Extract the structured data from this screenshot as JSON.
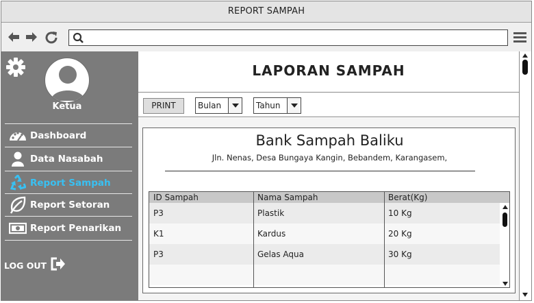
{
  "window": {
    "title": "REPORT SAMPAH"
  },
  "toolbar": {
    "back_icon": "arrow-left-icon",
    "forward_icon": "arrow-right-icon",
    "reload_icon": "reload-icon",
    "search_icon": "search-icon",
    "address_value": "",
    "menu_icon": "hamburger-menu-icon"
  },
  "sidebar": {
    "settings_icon": "gear-icon",
    "user_role": "Ketua",
    "items": [
      {
        "label": "Dashboard",
        "icon": "speedometer-icon",
        "active": false
      },
      {
        "label": "Data  Nasabah",
        "icon": "user-icon",
        "active": false
      },
      {
        "label": "Report Sampah",
        "icon": "recycle-icon",
        "active": true
      },
      {
        "label": "Report Setoran",
        "icon": "leaf-icon",
        "active": false
      },
      {
        "label": "Report Penarikan",
        "icon": "money-icon",
        "active": false
      }
    ],
    "logout_label": "LOG OUT",
    "logout_icon": "sign-out-icon",
    "active_color": "#39c0f2"
  },
  "main": {
    "page_title": "LAPORAN SAMPAH",
    "print_label": "PRINT",
    "filters": {
      "month_value": "Bulan",
      "year_value": "Tahun"
    },
    "report": {
      "org_name": "Bank Sampah Baliku",
      "org_address": "Jln. Nenas, Desa Bungaya Kangin, Bebandem, Karangasem,",
      "table": {
        "columns": [
          "ID Sampah",
          "Nama Sampah",
          "Berat(Kg)"
        ],
        "rows": [
          [
            "P3",
            "Plastik",
            "10 Kg"
          ],
          [
            "K1",
            "Kardus",
            "20 Kg"
          ],
          [
            "P3",
            "Gelas Aqua",
            "30 Kg"
          ]
        ]
      }
    }
  }
}
